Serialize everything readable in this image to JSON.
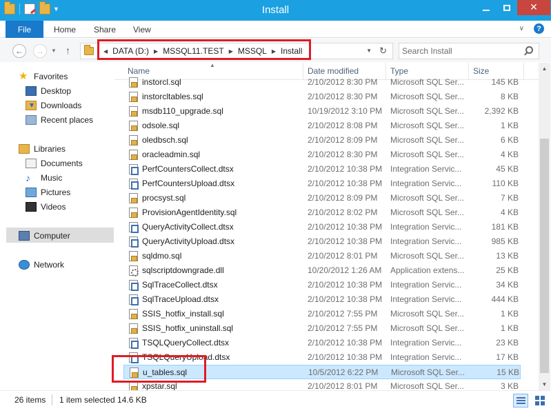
{
  "window": {
    "title": "Install",
    "close_glyph": "✕"
  },
  "ribbon": {
    "file": "File",
    "home": "Home",
    "share": "Share",
    "view": "View",
    "help": "?"
  },
  "navbar": {
    "back_glyph": "←",
    "forward_glyph": "→",
    "up_glyph": "↑",
    "refresh_glyph": "↻",
    "path": [
      "DATA (D:)",
      "MSSQL11.TEST",
      "MSSQL",
      "Install"
    ],
    "search_placeholder": "Search Install"
  },
  "sidebar": {
    "favorites": "Favorites",
    "desktop": "Desktop",
    "downloads": "Downloads",
    "recent_places": "Recent places",
    "libraries": "Libraries",
    "documents": "Documents",
    "music": "Music",
    "pictures": "Pictures",
    "videos": "Videos",
    "computer": "Computer",
    "network": "Network"
  },
  "columns": {
    "name": "Name",
    "date": "Date modified",
    "type": "Type",
    "size": "Size"
  },
  "files": [
    {
      "name": "instorcl.sql",
      "date": "2/10/2012 8:30 PM",
      "type": "Microsoft SQL Ser...",
      "size": "145 KB",
      "kind": "sql"
    },
    {
      "name": "instorcltables.sql",
      "date": "2/10/2012 8:30 PM",
      "type": "Microsoft SQL Ser...",
      "size": "8 KB",
      "kind": "sql"
    },
    {
      "name": "msdb110_upgrade.sql",
      "date": "10/19/2012 3:10 PM",
      "type": "Microsoft SQL Ser...",
      "size": "2,392 KB",
      "kind": "sql"
    },
    {
      "name": "odsole.sql",
      "date": "2/10/2012 8:08 PM",
      "type": "Microsoft SQL Ser...",
      "size": "1 KB",
      "kind": "sql"
    },
    {
      "name": "oledbsch.sql",
      "date": "2/10/2012 8:09 PM",
      "type": "Microsoft SQL Ser...",
      "size": "6 KB",
      "kind": "sql"
    },
    {
      "name": "oracleadmin.sql",
      "date": "2/10/2012 8:30 PM",
      "type": "Microsoft SQL Ser...",
      "size": "4 KB",
      "kind": "sql"
    },
    {
      "name": "PerfCountersCollect.dtsx",
      "date": "2/10/2012 10:38 PM",
      "type": "Integration Servic...",
      "size": "45 KB",
      "kind": "dtsx"
    },
    {
      "name": "PerfCountersUpload.dtsx",
      "date": "2/10/2012 10:38 PM",
      "type": "Integration Servic...",
      "size": "110 KB",
      "kind": "dtsx"
    },
    {
      "name": "procsyst.sql",
      "date": "2/10/2012 8:09 PM",
      "type": "Microsoft SQL Ser...",
      "size": "7 KB",
      "kind": "sql"
    },
    {
      "name": "ProvisionAgentIdentity.sql",
      "date": "2/10/2012 8:02 PM",
      "type": "Microsoft SQL Ser...",
      "size": "4 KB",
      "kind": "sql"
    },
    {
      "name": "QueryActivityCollect.dtsx",
      "date": "2/10/2012 10:38 PM",
      "type": "Integration Servic...",
      "size": "181 KB",
      "kind": "dtsx"
    },
    {
      "name": "QueryActivityUpload.dtsx",
      "date": "2/10/2012 10:38 PM",
      "type": "Integration Servic...",
      "size": "985 KB",
      "kind": "dtsx"
    },
    {
      "name": "sqldmo.sql",
      "date": "2/10/2012 8:01 PM",
      "type": "Microsoft SQL Ser...",
      "size": "13 KB",
      "kind": "sql"
    },
    {
      "name": "sqlscriptdowngrade.dll",
      "date": "10/20/2012 1:26 AM",
      "type": "Application extens...",
      "size": "25 KB",
      "kind": "dll"
    },
    {
      "name": "SqlTraceCollect.dtsx",
      "date": "2/10/2012 10:38 PM",
      "type": "Integration Servic...",
      "size": "34 KB",
      "kind": "dtsx"
    },
    {
      "name": "SqlTraceUpload.dtsx",
      "date": "2/10/2012 10:38 PM",
      "type": "Integration Servic...",
      "size": "444 KB",
      "kind": "dtsx"
    },
    {
      "name": "SSIS_hotfix_install.sql",
      "date": "2/10/2012 7:55 PM",
      "type": "Microsoft SQL Ser...",
      "size": "1 KB",
      "kind": "sql"
    },
    {
      "name": "SSIS_hotfix_uninstall.sql",
      "date": "2/10/2012 7:55 PM",
      "type": "Microsoft SQL Ser...",
      "size": "1 KB",
      "kind": "sql"
    },
    {
      "name": "TSQLQueryCollect.dtsx",
      "date": "2/10/2012 10:38 PM",
      "type": "Integration Servic...",
      "size": "23 KB",
      "kind": "dtsx"
    },
    {
      "name": "TSQLQueryUpload.dtsx",
      "date": "2/10/2012 10:38 PM",
      "type": "Integration Servic...",
      "size": "17 KB",
      "kind": "dtsx"
    },
    {
      "name": "u_tables.sql",
      "date": "10/5/2012 6:22 PM",
      "type": "Microsoft SQL Ser...",
      "size": "15 KB",
      "kind": "sql",
      "selected": true
    },
    {
      "name": "xpstar.sql",
      "date": "2/10/2012 8:01 PM",
      "type": "Microsoft SQL Ser...",
      "size": "3 KB",
      "kind": "sql"
    }
  ],
  "status": {
    "item_count": "26 items",
    "selection": "1 item selected  14.6 KB"
  },
  "colors": {
    "titlebar": "#1ba1e2",
    "file_tab": "#1979ca",
    "close_button": "#c7463e",
    "selection": "#cce8ff",
    "highlight_box": "#e01b24"
  }
}
